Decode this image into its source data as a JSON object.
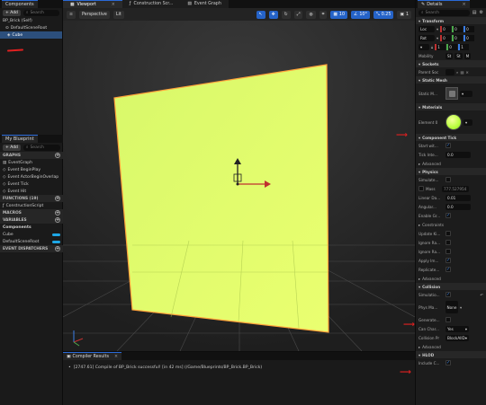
{
  "left": {
    "components_tab": "Components",
    "add_label": "+ Add",
    "search_placeholder": "Search",
    "tree": [
      "BP_Brick (Self)",
      "DefaultSceneRoot",
      "Cube"
    ],
    "bp_tab": "My Blueprint",
    "bp_add": "+ Add",
    "bp_search": "Search",
    "graphs_header": "GRAPHS",
    "graph_items": [
      "EventGraph",
      "Event BeginPlay",
      "Event ActorBeginOverlap",
      "Event Tick",
      "Event Hit"
    ],
    "functions_header": "FUNCTIONS (19)",
    "function_items": [
      "ConstructionScript"
    ],
    "macros_header": "MACROS",
    "variables_header": "VARIABLES",
    "components_header": "Components",
    "var_items": [
      "Cube",
      "DefaultSceneRoot"
    ],
    "dispatchers_header": "EVENT DISPATCHERS"
  },
  "center": {
    "tabs": [
      "Viewport",
      "Construction Scr...",
      "Event Graph"
    ],
    "perspective": "Perspective",
    "lit": "Lit",
    "toolbar_values": [
      "10",
      "10°",
      "0.25",
      "1"
    ],
    "compiler_tab": "Compiler Results",
    "compiler_message": "[2747.61] Compile of BP_Brick successful! [in 42 ms] (/Game/Blueprints/BP_Brick.BP_Brick)"
  },
  "right": {
    "tab": "Details",
    "search_placeholder": "Search",
    "transform_header": "Transform",
    "loc_label": "Loc",
    "rot_label": "Rot",
    "scale_label": "",
    "loc": [
      "0",
      "0",
      "0"
    ],
    "rot": [
      "0",
      "0",
      "0"
    ],
    "scale": [
      "1",
      "0",
      "1"
    ],
    "mobility_label": "Mobility",
    "mobility_opts": [
      "St",
      "St",
      "M"
    ],
    "sockets_header": "Sockets",
    "parent_socket_label": "Parent Soc",
    "static_mesh_header": "Static Mesh",
    "static_mesh_label": "Static M...",
    "materials_header": "Materials",
    "element_label": "Element 0",
    "component_tick_header": "Component Tick",
    "start_label": "Start wit...",
    "tick_label": "Tick Inte...",
    "tick_value": "0.0",
    "advanced_label": "Advanced",
    "physics_header": "Physics",
    "physics_rows": [
      "Simulate...",
      "Mass",
      "Linear Da...",
      "Angular...",
      "Enable Gr...",
      "Constraints",
      "Update Ki...",
      "Ignore Ra...",
      "Ignore Ra...",
      "Apply Im...",
      "Replicate..."
    ],
    "mass_value": "777.527954",
    "linear_value": "0.01",
    "angular_value": "0.0",
    "advanced2_label": "Advanced",
    "collision_header": "Collision",
    "simulation_label": "Simulatio...",
    "phys_mat_label": "Phys Ma...",
    "phys_mat_value": "None",
    "generate_label": "Generate...",
    "can_char_label": "Can Char...",
    "can_char_value": "Yes",
    "collision_preset_label": "Collision Pr",
    "collision_preset_value": "BlockAllD",
    "advanced3_label": "Advanced",
    "hlod_header": "HLOD",
    "include_label": "Include C..."
  },
  "colors": {
    "accent": "#2a6ad8",
    "plane": "#e6ff6a",
    "selection": "#2c4f7c",
    "annotation": "#e02020"
  }
}
